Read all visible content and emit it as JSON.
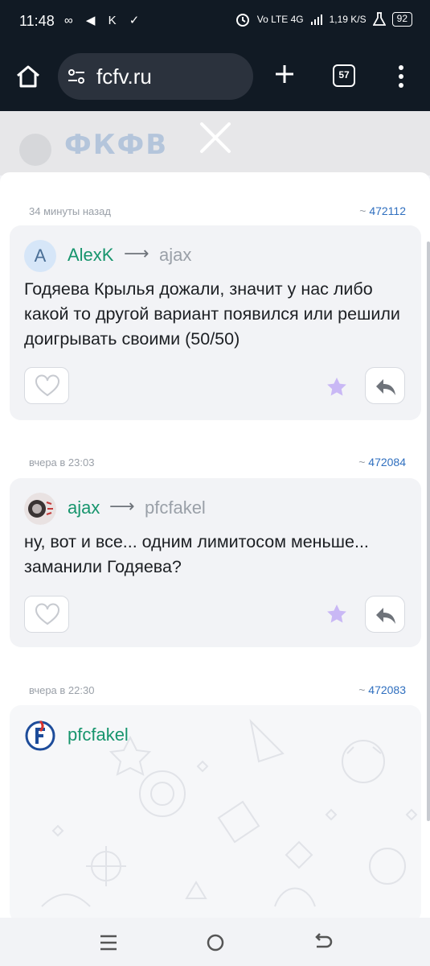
{
  "status_bar": {
    "time": "11:48",
    "left_icons": "∞ ◀ K ✓",
    "network": "Vo LTE 4G",
    "speed": "1,19 K/S",
    "battery": "92"
  },
  "browser": {
    "url": "fcfv.ru",
    "tab_count": "57"
  },
  "background_page": {
    "logo_text": "ФКФВ"
  },
  "comments": [
    {
      "time": "34 минуты назад",
      "id_prefix": "~",
      "id": "472112",
      "avatar_letter": "A",
      "author": "AlexK",
      "arrow": "⟶",
      "reply_to": "ajax",
      "text": "Годяева Крылья дожали, значит у нас либо какой то другой вариант появился или решили доигрывать своими (50/50)"
    },
    {
      "time": "вчера в 23:03",
      "id_prefix": "~",
      "id": "472084",
      "author": "ajax",
      "arrow": "⟶",
      "reply_to": "pfcfakel",
      "text": "ну, вот и все... одним лимитосом меньше... заманили Годяева?"
    },
    {
      "time": "вчера в 22:30",
      "id_prefix": "~",
      "id": "472083",
      "author": "pfcfakel"
    }
  ],
  "colors": {
    "author_green": "#17956d",
    "link_blue": "#2f6fbf",
    "star_lilac": "#c9b8f5",
    "header_dark": "#111a24"
  }
}
